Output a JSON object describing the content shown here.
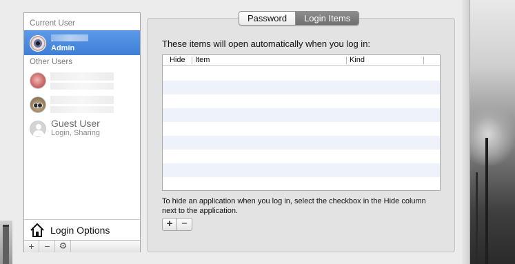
{
  "sidebar": {
    "current_user_label": "Current User",
    "current_user": {
      "name": ".",
      "role": "Admin"
    },
    "other_users_label": "Other Users",
    "guest": {
      "name": "Guest User",
      "subtitle": "Login, Sharing"
    },
    "login_options": "Login Options",
    "bottom_buttons": {
      "add": "+",
      "remove": "−",
      "action": "⚙"
    }
  },
  "tabs": [
    {
      "label": "Password",
      "selected": false
    },
    {
      "label": "Login Items",
      "selected": true
    }
  ],
  "login_items": {
    "description": "These items will open automatically when you log in:",
    "columns": {
      "hide": "Hide",
      "item": "Item",
      "kind": "Kind"
    },
    "rows": [],
    "hint": "To hide an application when you log in, select the checkbox in the Hide column next to the application.",
    "add_label": "+",
    "remove_label": "−"
  },
  "colors": {
    "selection": "#3e7ed7",
    "active_tab": "#7a7a7a",
    "alt_row": "#eef3fb"
  }
}
